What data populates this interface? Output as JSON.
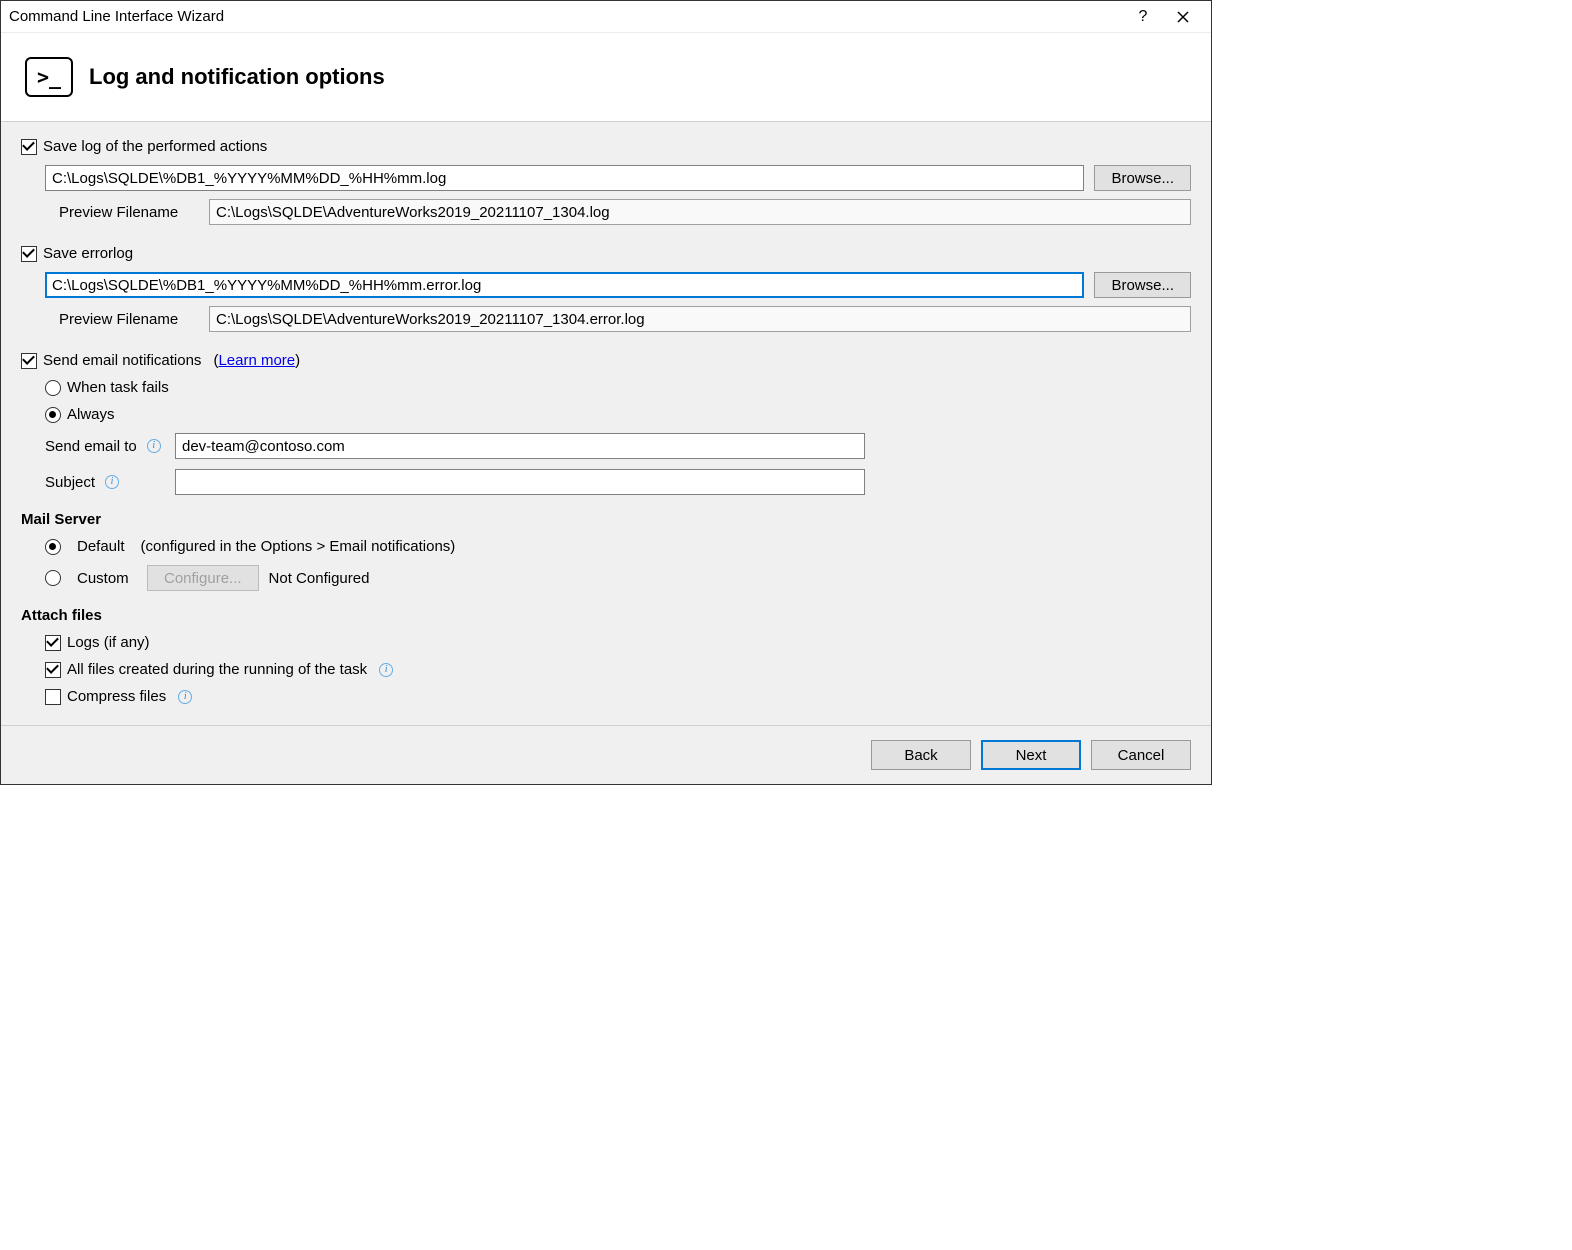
{
  "window": {
    "title": "Command Line Interface Wizard"
  },
  "header": {
    "title": "Log and notification options",
    "icon_label": ">_"
  },
  "log": {
    "save_log_label": "Save log of the performed actions",
    "save_log_checked": true,
    "log_path": "C:\\Logs\\SQLDE\\%DB1_%YYYY%MM%DD_%HH%mm.log",
    "browse_label": "Browse...",
    "preview_label": "Preview Filename",
    "log_preview": "C:\\Logs\\SQLDE\\AdventureWorks2019_20211107_1304.log"
  },
  "errorlog": {
    "save_errorlog_label": "Save errorlog",
    "save_errorlog_checked": true,
    "errorlog_path": "C:\\Logs\\SQLDE\\%DB1_%YYYY%MM%DD_%HH%mm.error.log",
    "browse_label": "Browse...",
    "preview_label": "Preview Filename",
    "errorlog_preview": "C:\\Logs\\SQLDE\\AdventureWorks2019_20211107_1304.error.log"
  },
  "email": {
    "send_email_label": "Send email notifications",
    "send_email_checked": true,
    "learn_more_label": "Learn more",
    "when_fails_label": "When task fails",
    "always_label": "Always",
    "selected_option": "always",
    "send_to_label": "Send email to",
    "send_to_value": "dev-team@contoso.com",
    "subject_label": "Subject",
    "subject_value": ""
  },
  "mail_server": {
    "heading": "Mail Server",
    "default_label": "Default",
    "default_note": "(configured in the Options > Email notifications)",
    "custom_label": "Custom",
    "configure_label": "Configure...",
    "custom_status": "Not Configured",
    "selected": "default"
  },
  "attach": {
    "heading": "Attach files",
    "logs_label": "Logs (if any)",
    "logs_checked": true,
    "all_files_label": "All files created during the running of the task",
    "all_files_checked": true,
    "compress_label": "Compress files",
    "compress_checked": false
  },
  "footer": {
    "back_label": "Back",
    "next_label": "Next",
    "cancel_label": "Cancel"
  }
}
